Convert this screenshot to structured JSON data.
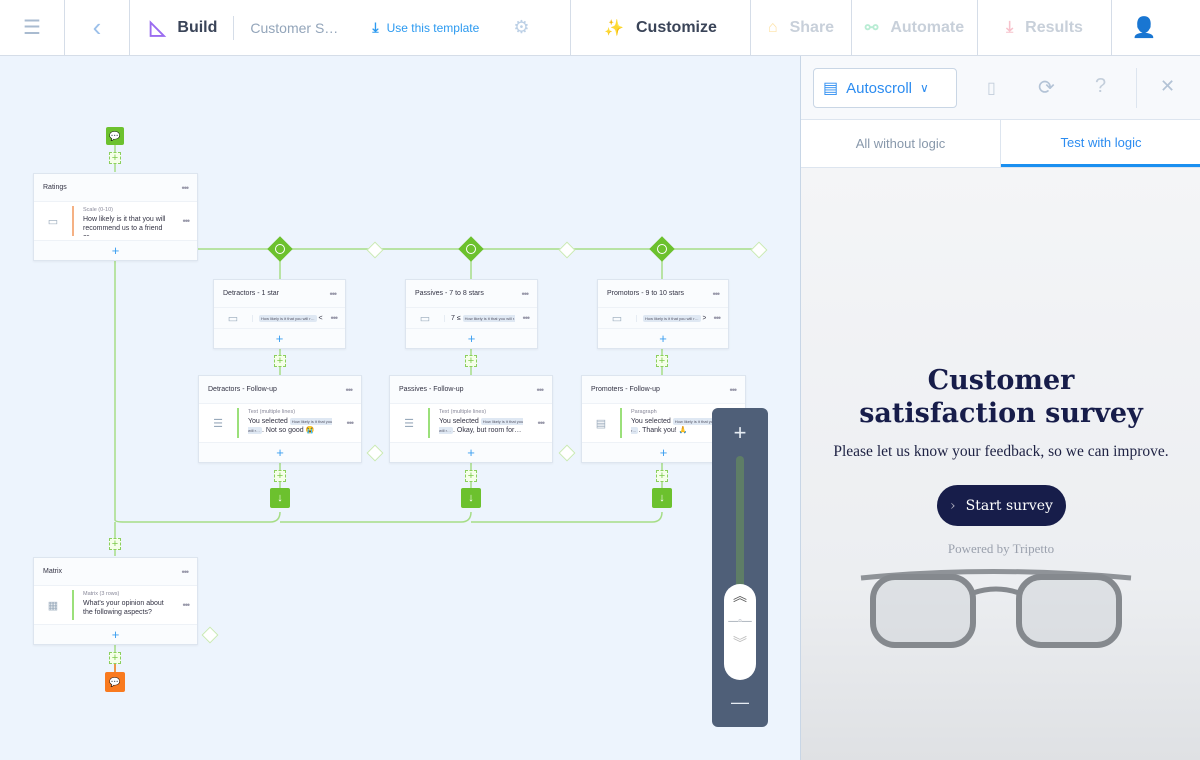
{
  "topbar": {
    "build": "Build",
    "form_name": "Customer S…",
    "use_template": "Use this template",
    "customize": "Customize",
    "share": "Share",
    "automate": "Automate",
    "results": "Results"
  },
  "canvas": {
    "cards": [
      {
        "id": "ratings",
        "title": "Ratings",
        "type": "Scale (0-10)",
        "text": "How likely is it that you will recommend us to a friend or…",
        "icon": "scale-icon",
        "accent": "#f5b184"
      },
      {
        "id": "detractors",
        "title": "Detractors - 1 star",
        "cond_pre": "",
        "chip": "How likely is it that you will r…",
        "cond_post": "< 7…"
      },
      {
        "id": "passives",
        "title": "Passives - 7 to 8 stars",
        "cond_pre": "7 ≤",
        "chip": "How likely is it that you will r…",
        "cond_post": "…"
      },
      {
        "id": "promotors",
        "title": "Promotors - 9 to 10 stars",
        "cond_pre": "",
        "chip": "How likely is it that you will r…",
        "cond_post": "> 8…"
      },
      {
        "id": "detractors-followup",
        "title": "Detractors - Follow-up",
        "type": "Text (multiple lines)",
        "pre": "You selected",
        "chip": "How likely is it that you will r…",
        "text": ". Not so good 😭",
        "icon": "text-lines-icon",
        "accent": "#9be07a"
      },
      {
        "id": "passives-followup",
        "title": "Passives - Follow-up",
        "type": "Text (multiple lines)",
        "pre": "You selected",
        "chip": "How likely is it that you will r…",
        "text": ". Okay, but room for…",
        "icon": "text-lines-icon",
        "accent": "#9be07a"
      },
      {
        "id": "promoters-followup",
        "title": "Promoters - Follow-up",
        "type": "Paragraph",
        "pre": "You selected",
        "chip": "How likely is it that you will r…",
        "text": ". Thank you! 🙏",
        "icon": "paragraph-icon",
        "accent": "#9be07a"
      },
      {
        "id": "matrix",
        "title": "Matrix",
        "type": "Matrix (3 rows)",
        "text": "What's your opinion about the following aspects?",
        "icon": "matrix-icon",
        "accent": "#9be07a"
      }
    ],
    "colors": {
      "branch": "#6cc12e",
      "end": "#f97a1f",
      "start": "#6cc12e"
    }
  },
  "preview": {
    "mode": "Autoscroll",
    "tabs": [
      "All without logic",
      "Test with logic"
    ],
    "active_tab": 1,
    "title": "Customer satisfaction survey",
    "description": "Please let us know your feedback, so we can improve.",
    "start": "Start survey",
    "powered": "Powered by Tripetto"
  }
}
